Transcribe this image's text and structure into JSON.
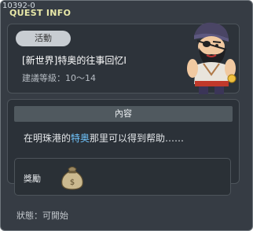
{
  "quest": {
    "id": "10392-0",
    "window_title": "QUEST INFO",
    "category_badge": "活動",
    "name": "[新世界]特奥的往事回忆I",
    "level": "建議等級：10～14"
  },
  "content": {
    "header": "內容",
    "text_before": "在明珠港的",
    "highlight": "特奥",
    "text_after": "那里可以得到帮助……"
  },
  "reward": {
    "label": "獎勵",
    "item_icon": "money-bag-icon"
  },
  "status": {
    "label": "狀態：可開始"
  },
  "colors": {
    "window_bg": "#363c44",
    "title": "#e8e8a8",
    "highlight": "#70c6ff"
  }
}
